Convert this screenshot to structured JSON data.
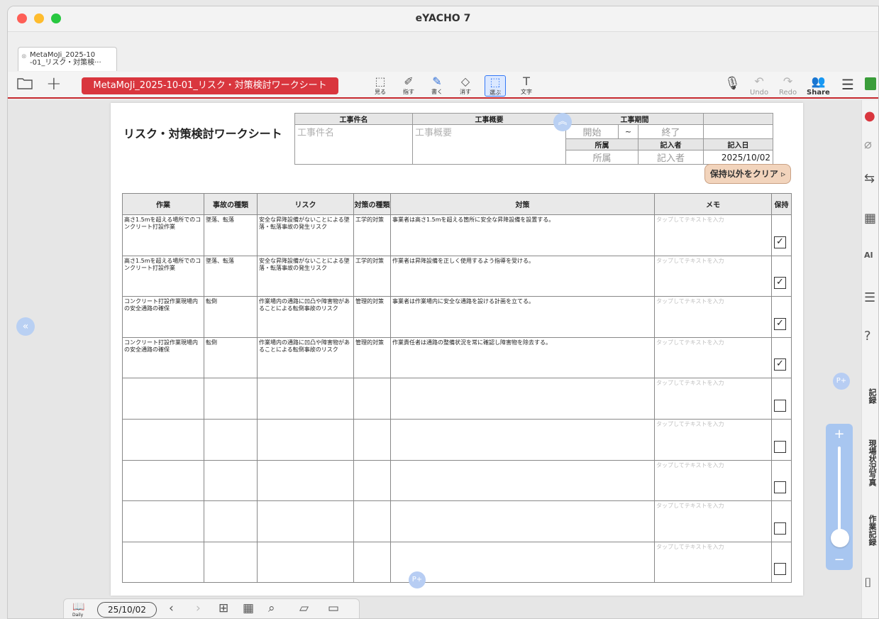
{
  "app": {
    "title": "eYACHO 7",
    "colors": {
      "accent": "#d9363e",
      "clear_button": "#f2d4bc",
      "blue_hint": "#b9d0f3"
    }
  },
  "tab": {
    "label": "MetaMoJi_2025-10\n-01_リスク・対策検···",
    "close_icon": "close-icon"
  },
  "toolbar": {
    "doc_title": "MetaMoJi_2025-10-01_リスク・対策検討ワークシート",
    "tools": [
      {
        "label": "見る",
        "icon": "view-icon"
      },
      {
        "label": "指す",
        "icon": "pointer-icon"
      },
      {
        "label": "書く",
        "icon": "pen-icon"
      },
      {
        "label": "消す",
        "icon": "eraser-icon"
      },
      {
        "label": "選ぶ",
        "icon": "lasso-icon"
      },
      {
        "label": "文字",
        "icon": "text-icon"
      }
    ],
    "undo": "Undo",
    "redo": "Redo",
    "share": "Share"
  },
  "sheet": {
    "title": "リスク・対策検討ワークシート",
    "header": {
      "project_name_label": "工事件名",
      "project_name_ph": "工事件名",
      "overview_label": "工事概要",
      "overview_ph": "工事概要",
      "period_label": "工事期間",
      "start_ph": "開始",
      "tilde": "~",
      "end_ph": "終了",
      "dept_label": "所属",
      "dept_ph": "所属",
      "writer_label": "記入者",
      "writer_ph": "記入者",
      "date_label": "記入日",
      "date_value": "2025/10/02"
    },
    "clear_button": "保持以外をクリア ▹",
    "columns": [
      "作業",
      "事故の種類",
      "リスク",
      "対策の種類",
      "対策",
      "メモ",
      "保持"
    ],
    "memo_placeholder": "タップしてテキストを入力",
    "rows": [
      {
        "work": "高さ1.5mを超える場所でのコンクリート打設作業",
        "accident": "墜落、転落",
        "risk": "安全な昇降設備がないことによる墜落・転落事故の発生リスク",
        "type": "工学的対策",
        "measure": "事業者は高さ1.5mを超える箇所に安全な昇降設備を設置する。",
        "keep": true
      },
      {
        "work": "高さ1.5mを超える場所でのコンクリート打設作業",
        "accident": "墜落、転落",
        "risk": "安全な昇降設備がないことによる墜落・転落事故の発生リスク",
        "type": "工学的対策",
        "measure": "作業者は昇降設備を正しく使用するよう指導を受ける。",
        "keep": true
      },
      {
        "work": "コンクリート打設作業現場内の安全通路の確保",
        "accident": "転倒",
        "risk": "作業場内の通路に凹凸や障害物があることによる転倒事故のリスク",
        "type": "管理的対策",
        "measure": "事業者は作業場内に安全な通路を設ける計画を立てる。",
        "keep": true
      },
      {
        "work": "コンクリート打設作業現場内の安全通路の確保",
        "accident": "転倒",
        "risk": "作業場内の通路に凹凸や障害物があることによる転倒事故のリスク",
        "type": "管理的対策",
        "measure": "作業責任者は通路の整備状況を常に確認し障害物を除去する。",
        "keep": true
      },
      {
        "work": "",
        "accident": "",
        "risk": "",
        "type": "",
        "measure": "",
        "keep": false
      },
      {
        "work": "",
        "accident": "",
        "risk": "",
        "type": "",
        "measure": "",
        "keep": false
      },
      {
        "work": "",
        "accident": "",
        "risk": "",
        "type": "",
        "measure": "",
        "keep": false
      },
      {
        "work": "",
        "accident": "",
        "risk": "",
        "type": "",
        "measure": "",
        "keep": false
      },
      {
        "work": "",
        "accident": "",
        "risk": "",
        "type": "",
        "measure": "",
        "keep": false
      }
    ]
  },
  "page_add_label": "P+",
  "right_rail": {
    "labels": [
      "記録",
      "現場状況写真",
      "作業記録"
    ]
  },
  "bottom_bar": {
    "daily_label": "Daily",
    "date": "25/10/02"
  }
}
